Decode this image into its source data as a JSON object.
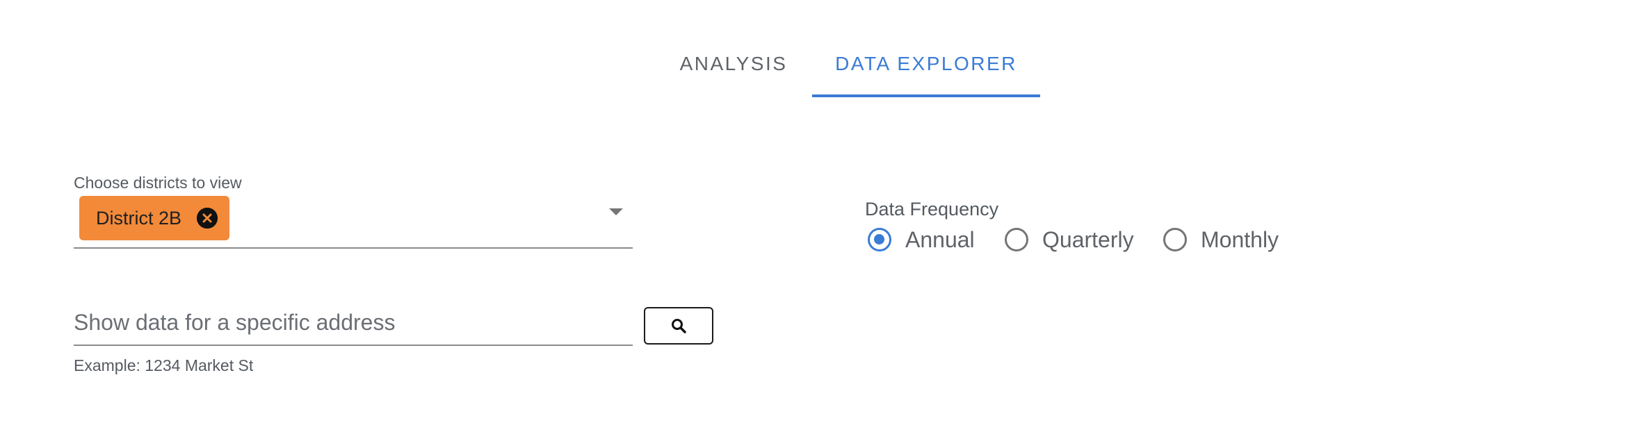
{
  "tabs": {
    "analysis": "ANALYSIS",
    "data_explorer": "DATA EXPLORER",
    "active": "data_explorer"
  },
  "districts": {
    "label": "Choose districts to view",
    "selected": [
      "District 2B"
    ],
    "chip_color": "#f28a3a"
  },
  "frequency": {
    "label": "Data Frequency",
    "options": [
      "Annual",
      "Quarterly",
      "Monthly"
    ],
    "selected": "Annual"
  },
  "address": {
    "placeholder": "Show data for a specific address",
    "value": "",
    "helper": "Example: 1234 Market St",
    "search_icon": "search-icon"
  },
  "colors": {
    "accent": "#3a7bd5",
    "chip": "#f28a3a",
    "text_muted": "#5f6368"
  }
}
